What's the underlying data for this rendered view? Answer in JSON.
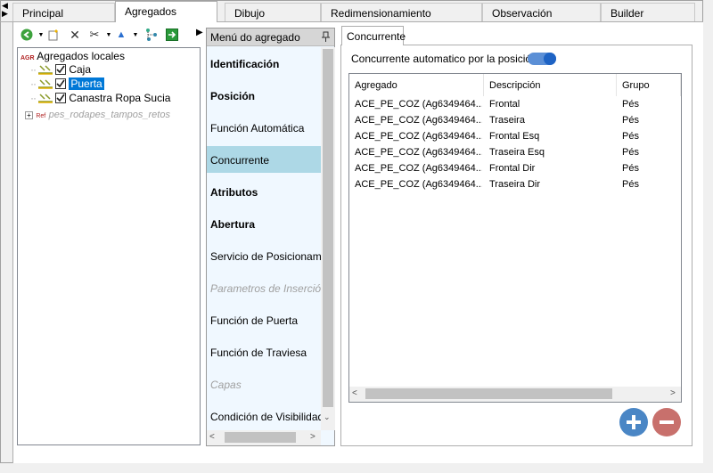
{
  "tabs": [
    "Principal",
    "Agregados",
    "Dibujo",
    "Redimensionamiento",
    "Observación",
    "Builder"
  ],
  "active_tab": "Agregados",
  "tree": {
    "root_tag": "AGR",
    "root_label": "Agregados locales",
    "children": [
      {
        "label": "Caja",
        "checked": true
      },
      {
        "label": "Puerta",
        "checked": true,
        "selected": true
      },
      {
        "label": "Canastra Ropa Sucia",
        "checked": true
      }
    ],
    "ref_tag": "Ref",
    "ref_label": "pes_rodapes_tampos_retos"
  },
  "menu": {
    "title": "Menú do agregado",
    "pin_glyph": "📌",
    "items": [
      {
        "label": "Identificación",
        "style": "bold"
      },
      {
        "label": "Posición",
        "style": "bold"
      },
      {
        "label": "Función Automática",
        "style": "normal"
      },
      {
        "label": "Concurrente",
        "style": "active"
      },
      {
        "label": "Atributos",
        "style": "bold"
      },
      {
        "label": "Abertura",
        "style": "bold"
      },
      {
        "label": "Servicio de Posicionamiento",
        "style": "normal"
      },
      {
        "label": "Parametros de Inserción",
        "style": "disabled"
      },
      {
        "label": "Función de Puerta",
        "style": "normal"
      },
      {
        "label": "Función de Traviesa",
        "style": "normal"
      },
      {
        "label": "Capas",
        "style": "disabled"
      },
      {
        "label": "Condición de Visibilidad",
        "style": "normal"
      }
    ]
  },
  "right": {
    "tab_label": "Concurrente",
    "auto_label": "Concurrente automatico por la posición",
    "auto_on": true,
    "columns": [
      "Agregado",
      "Descripción",
      "Grupo"
    ],
    "rows": [
      [
        "ACE_PE_COZ (Ag6349464...",
        "Frontal",
        "Pés"
      ],
      [
        "ACE_PE_COZ (Ag6349464...",
        "Traseira",
        "Pés"
      ],
      [
        "ACE_PE_COZ (Ag6349464...",
        "Frontal Esq",
        "Pés"
      ],
      [
        "ACE_PE_COZ (Ag6349464...",
        "Traseira Esq",
        "Pés"
      ],
      [
        "ACE_PE_COZ (Ag6349464...",
        "Frontal Dir",
        "Pés"
      ],
      [
        "ACE_PE_COZ (Ag6349464...",
        "Traseira Dir",
        "Pés"
      ]
    ]
  },
  "colors": {
    "add": "#4a86c5",
    "remove": "#c8706c",
    "selection": "#0078d7",
    "menu_active": "#add8e6"
  }
}
